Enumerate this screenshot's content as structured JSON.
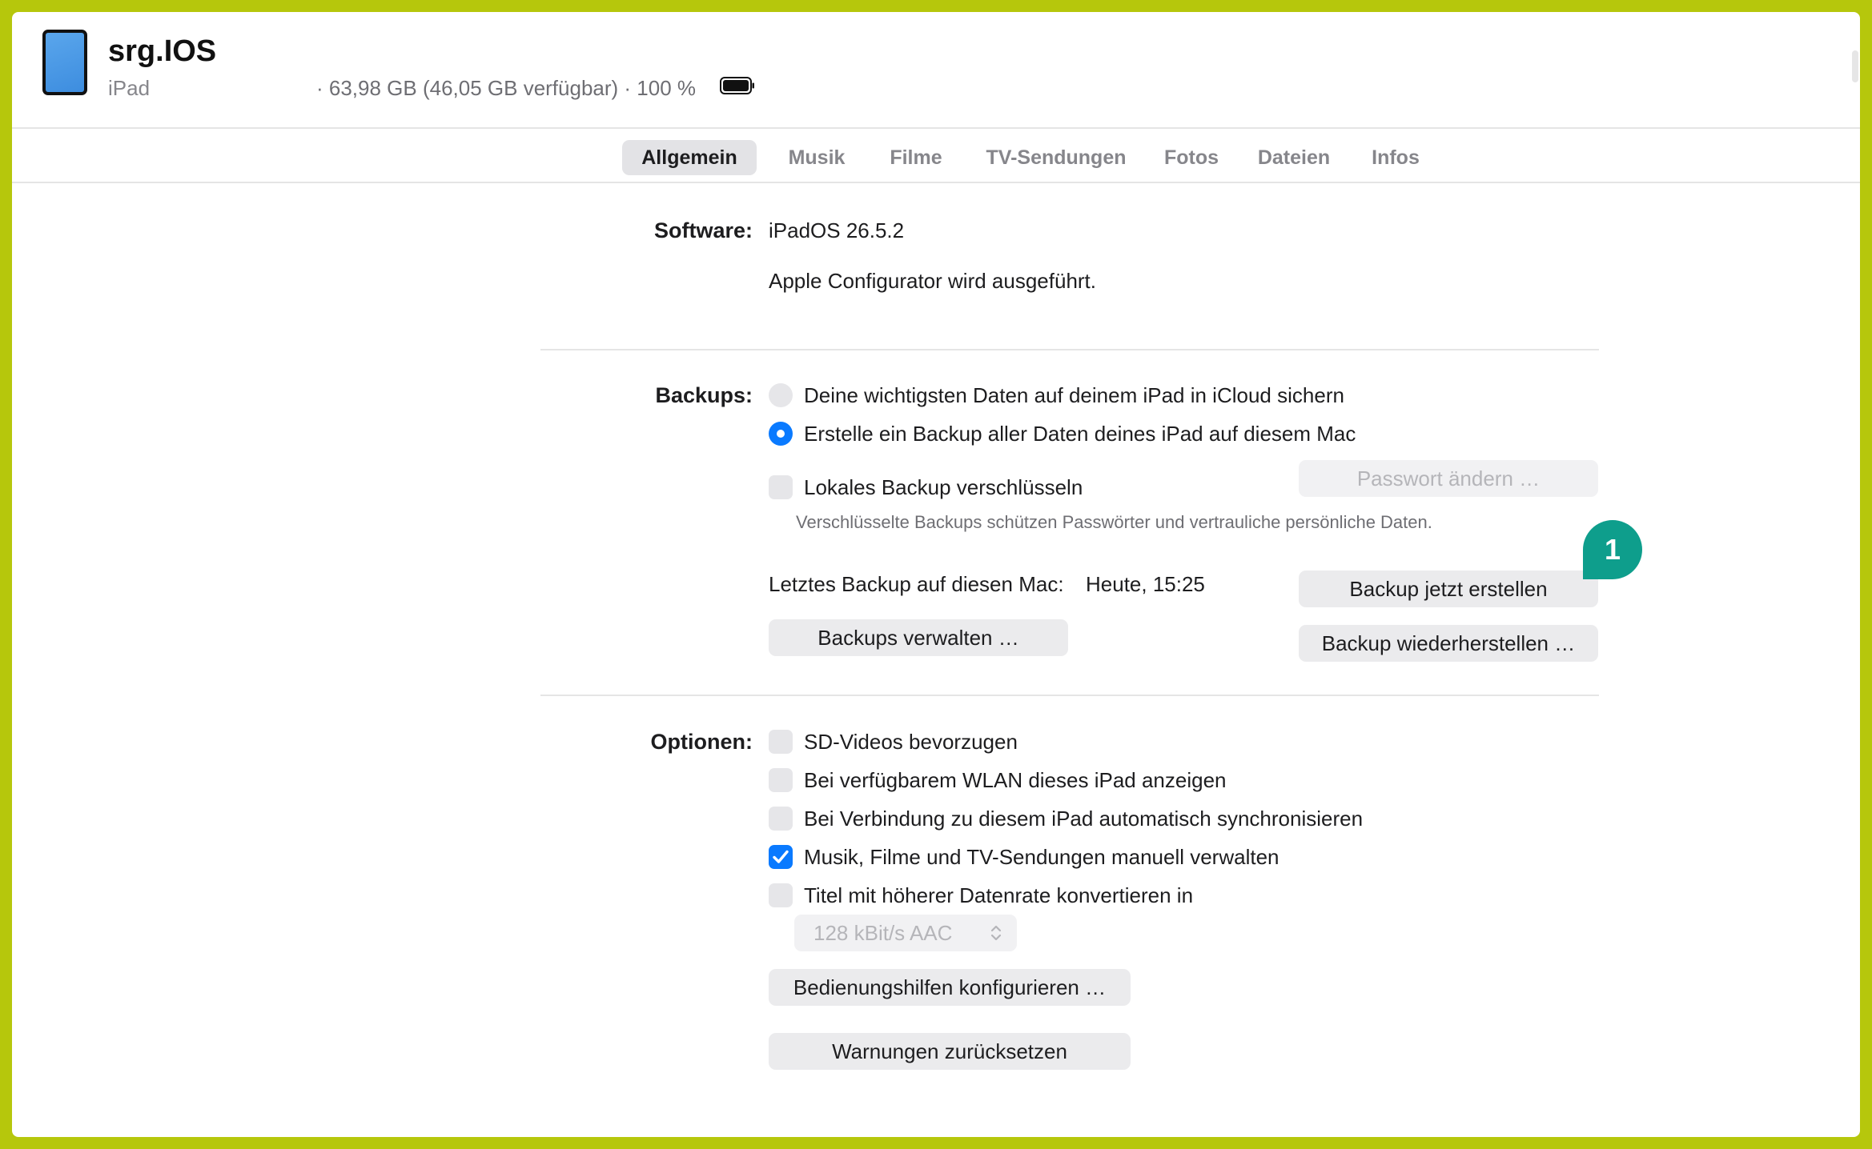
{
  "device": {
    "name": "srg.IOS",
    "model": "iPad",
    "storage_info": "· 63,98 GB (46,05 GB verfügbar) · 100 %",
    "icon": "ipad-icon"
  },
  "tabs": [
    {
      "label": "Allgemein",
      "active": true
    },
    {
      "label": "Musik",
      "active": false
    },
    {
      "label": "Filme",
      "active": false
    },
    {
      "label": "TV-Sendungen",
      "active": false
    },
    {
      "label": "Fotos",
      "active": false
    },
    {
      "label": "Dateien",
      "active": false
    },
    {
      "label": "Infos",
      "active": false
    }
  ],
  "software": {
    "label": "Software:",
    "version": "iPadOS 26.5.2",
    "status": "Apple Configurator wird ausgeführt."
  },
  "backups": {
    "label": "Backups:",
    "option_icloud": "Deine wichtigsten Daten auf deinem iPad in iCloud sichern",
    "option_mac": "Erstelle ein Backup aller Daten deines iPad auf diesem Mac",
    "selected": "option_mac",
    "encrypt_label": "Lokales Backup verschlüsseln",
    "encrypt_checked": false,
    "change_password_button": "Passwort ändern …",
    "encrypt_note": "Verschlüsselte Backups schützen Passwörter und vertrauliche persönliche Daten.",
    "last_backup_label": "Letztes Backup auf diesen Mac:",
    "last_backup_value": "Heute, 15:25",
    "backup_now_button": "Backup jetzt erstellen",
    "manage_button": "Backups verwalten …",
    "restore_button": "Backup wiederherstellen …"
  },
  "options": {
    "label": "Optionen:",
    "items": [
      {
        "label": "SD-Videos bevorzugen",
        "checked": false
      },
      {
        "label": "Bei verfügbarem WLAN dieses iPad anzeigen",
        "checked": false
      },
      {
        "label": "Bei Verbindung zu diesem iPad automatisch synchronisieren",
        "checked": false
      },
      {
        "label": "Musik, Filme und TV-Sendungen manuell verwalten",
        "checked": true
      },
      {
        "label": "Titel mit höherer Datenrate konvertieren in",
        "checked": false
      }
    ],
    "bitrate_select": "128 kBit/s AAC",
    "accessibility_button": "Bedienungshilfen konfigurieren …",
    "reset_warnings_button": "Warnungen zurücksetzen"
  },
  "callout": {
    "number": "1",
    "color": "#0e9e8c"
  },
  "colors": {
    "accent": "#0a7aff",
    "frame": "#b6c70c"
  }
}
